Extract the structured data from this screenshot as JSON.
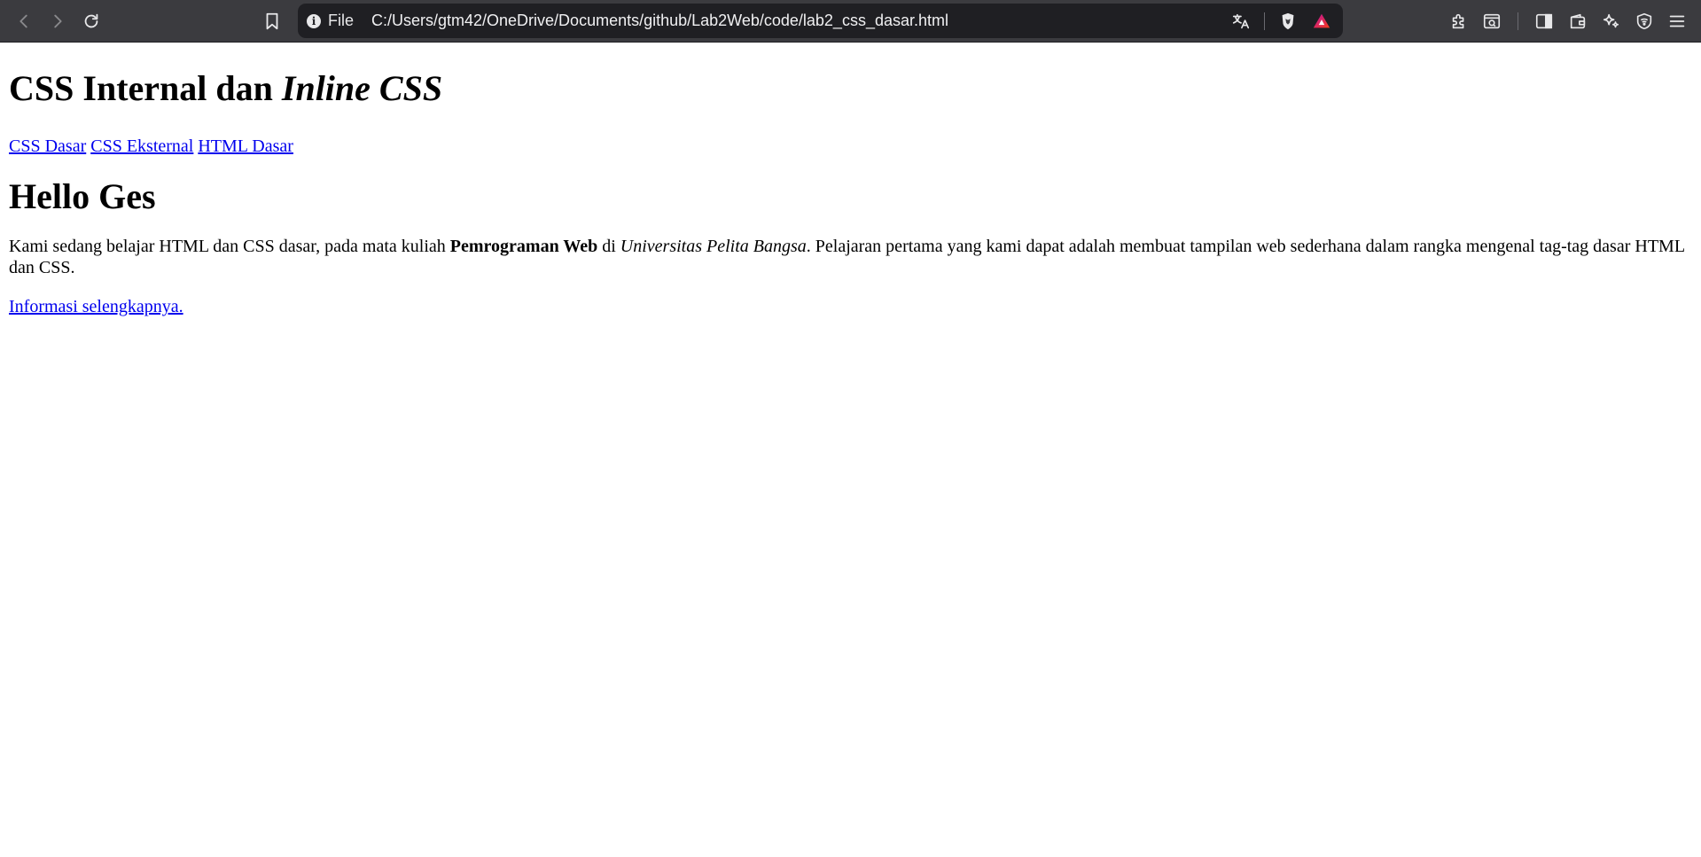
{
  "browser": {
    "site_info_label": "File",
    "url": "C:/Users/gtm42/OneDrive/Documents/github/Lab2Web/code/lab2_css_dasar.html",
    "icons": {
      "back": "back-arrow-icon",
      "forward": "forward-arrow-icon",
      "reload": "reload-icon",
      "bookmark": "bookmark-icon",
      "site_info": "info-icon",
      "translate": "translate-icon",
      "shields": "brave-shields-icon",
      "rewards": "brave-rewards-icon",
      "extensions": "extensions-icon",
      "reader": "reader-mode-icon",
      "sidebar": "sidebar-icon",
      "wallet": "wallet-icon",
      "leo": "leo-ai-icon",
      "vpn": "vpn-icon",
      "menu": "menu-icon"
    },
    "colors": {
      "toolbar_bg": "#3b3b3f",
      "urlbar_bg": "#1f1f23",
      "brave_orange": "#fb542b",
      "rewards_gradient_start": "#bf14a2",
      "rewards_gradient_end": "#f73a1c"
    }
  },
  "page": {
    "title_plain": "CSS Internal dan ",
    "title_italic": "Inline CSS",
    "nav_links": [
      "CSS Dasar",
      "CSS Eksternal",
      "HTML Dasar"
    ],
    "heading": "Hello Ges",
    "paragraph": {
      "part1": "Kami sedang belajar HTML dan CSS dasar, pada mata kuliah ",
      "bold": "Pemrograman Web",
      "part2": " di ",
      "italic": "Universitas Pelita Bangsa",
      "part3": ". Pelajaran pertama yang kami dapat adalah membuat tampilan web sederhana dalam rangka mengenal tag-tag dasar HTML dan CSS."
    },
    "more_link": "Informasi selengkapnya.",
    "colors": {
      "link": "#0000ee",
      "text": "#000000",
      "background": "#ffffff"
    }
  }
}
